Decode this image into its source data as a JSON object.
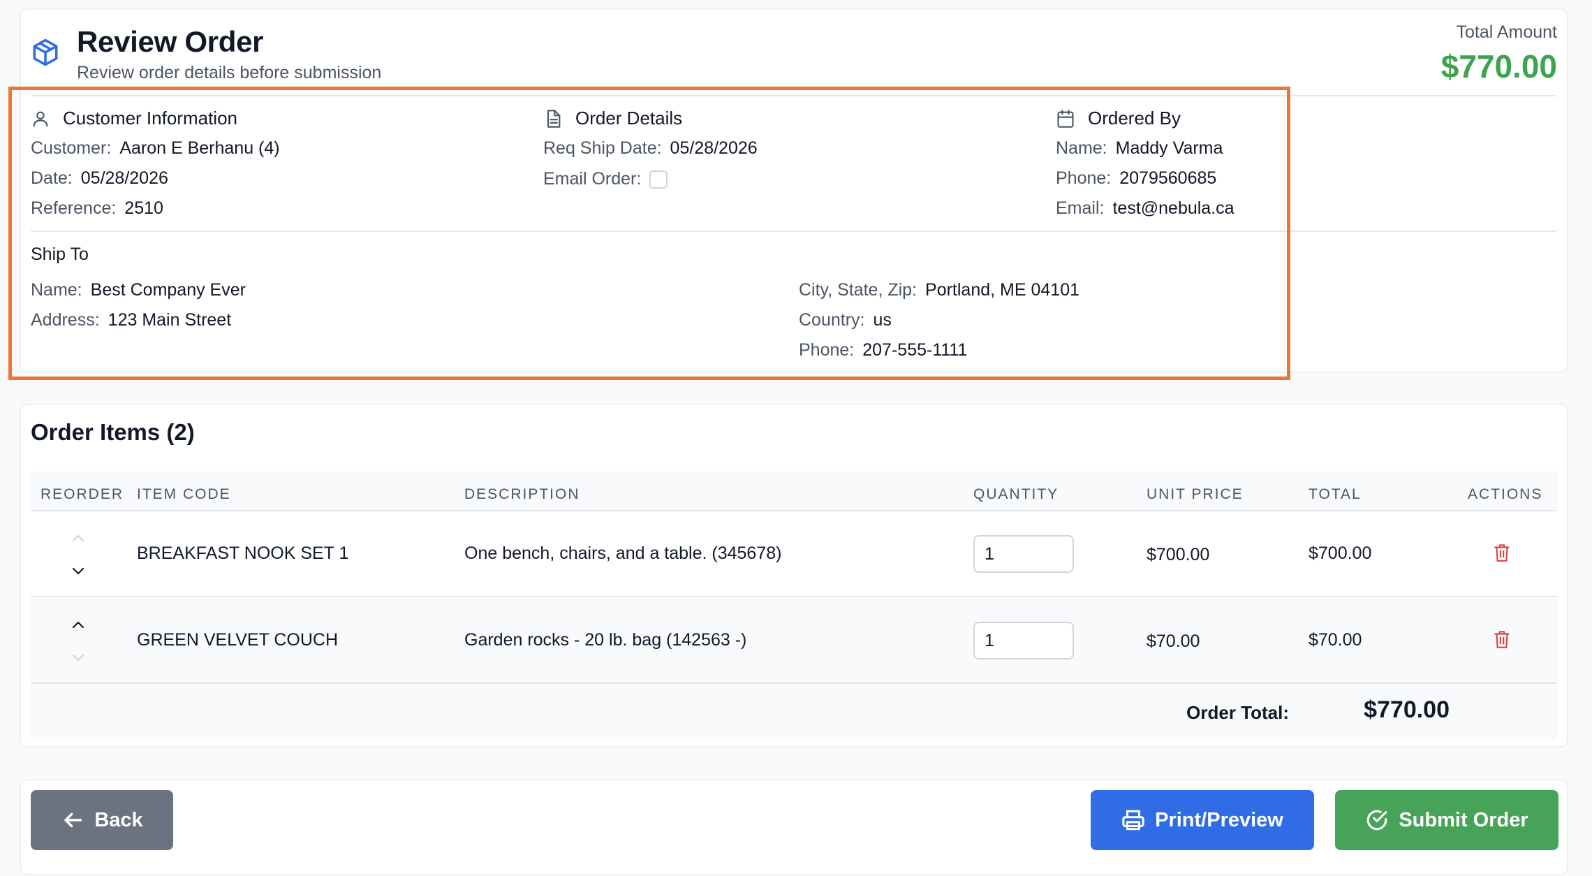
{
  "header": {
    "title": "Review Order",
    "subtitle": "Review order details before submission",
    "total_label": "Total Amount",
    "total_value": "$770.00",
    "icon": "package-icon"
  },
  "customer_info": {
    "heading": "Customer Information",
    "icon": "user-icon",
    "customer_label": "Customer:",
    "customer_value": "Aaron E Berhanu (4)",
    "date_label": "Date:",
    "date_value": "05/28/2026",
    "reference_label": "Reference:",
    "reference_value": "2510"
  },
  "order_details": {
    "heading": "Order Details",
    "icon": "document-icon",
    "ship_date_label": "Req Ship Date:",
    "ship_date_value": "05/28/2026",
    "email_order_label": "Email Order:",
    "email_order_checked": false
  },
  "ordered_by": {
    "heading": "Ordered By",
    "icon": "calendar-icon",
    "name_label": "Name:",
    "name_value": "Maddy Varma",
    "phone_label": "Phone:",
    "phone_value": "2079560685",
    "email_label": "Email:",
    "email_value": "test@nebula.ca"
  },
  "ship_to": {
    "heading": "Ship To",
    "name_label": "Name:",
    "name_value": "Best Company Ever",
    "address_label": "Address:",
    "address_value": "123 Main Street",
    "city_label": "City, State, Zip:",
    "city_value": "Portland, ME 04101",
    "country_label": "Country:",
    "country_value": "us",
    "phone_label": "Phone:",
    "phone_value": "207-555-1111"
  },
  "items": {
    "title": "Order Items (2)",
    "columns": [
      "REORDER",
      "ITEM CODE",
      "DESCRIPTION",
      "QUANTITY",
      "UNIT PRICE",
      "TOTAL",
      "ACTIONS"
    ],
    "rows": [
      {
        "code": "BREAKFAST NOOK SET 1",
        "description": "One bench, chairs, and a table. (345678)",
        "quantity": "1",
        "unit_price": "$700.00",
        "total": "$700.00"
      },
      {
        "code": "GREEN VELVET COUCH",
        "description": "Garden rocks - 20 lb. bag (142563 -)",
        "quantity": "1",
        "unit_price": "$70.00",
        "total": "$70.00"
      }
    ],
    "order_total_label": "Order Total:",
    "order_total_value": "$770.00"
  },
  "actions": {
    "back_label": "Back",
    "print_label": "Print/Preview",
    "submit_label": "Submit Order"
  },
  "colors": {
    "accent_green": "#3fa34d",
    "primary_blue": "#2f6ce5",
    "back_gray": "#6b7280",
    "highlight_orange": "#ec7634",
    "danger_red": "#e04343"
  }
}
